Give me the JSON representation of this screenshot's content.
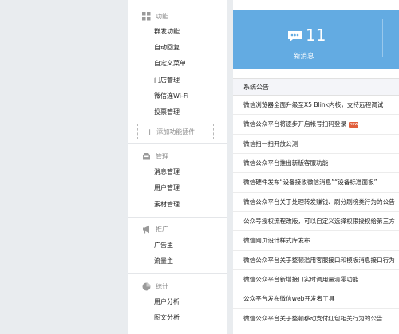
{
  "sidebar": {
    "sections": [
      {
        "title": "功能",
        "icon": "grid-icon",
        "items": [
          "群发功能",
          "自动回复",
          "自定义菜单",
          "门店管理",
          "微信连Wi-Fi",
          "投票管理"
        ]
      },
      {
        "title": "管理",
        "icon": "inbox-icon",
        "items": [
          "消息管理",
          "用户管理",
          "素材管理"
        ]
      },
      {
        "title": "推广",
        "icon": "megaphone-icon",
        "items": [
          "广告主",
          "流量主"
        ]
      },
      {
        "title": "统计",
        "icon": "pie-chart-icon",
        "items": [
          "用户分析",
          "图文分析"
        ]
      }
    ],
    "add_plugin_label": "添加功能插件"
  },
  "stats": {
    "new_messages_count": "11",
    "new_messages_label": "新消息",
    "accent_color": "#63abe2"
  },
  "notices": {
    "header": "系统公告",
    "new_badge": "new",
    "items": [
      "微信浏览器全面升级至X5 Blink内核，支持远程调试",
      "微信公众平台将逐步开启帐号扫码登录",
      "微信扫一扫开放公测",
      "微信公众平台推出新版客服功能",
      "微信硬件发布“设备接收微信消息”“设备标准面板”",
      "微信公众平台关于处理转发赚钱、刷分刷榜类行为的公告",
      "公众号授权流程改版，可以自定义选择权限授权给第三方",
      "微信网页设计样式库发布",
      "微信公众平台关于整顿滥用客服接口和模板消息接口行为",
      "微信公众平台新增接口实时调用量清零功能",
      "公众平台发布微信web开发者工具",
      "微信公众平台关于整顿移动支付红包相关行为的公告"
    ]
  }
}
